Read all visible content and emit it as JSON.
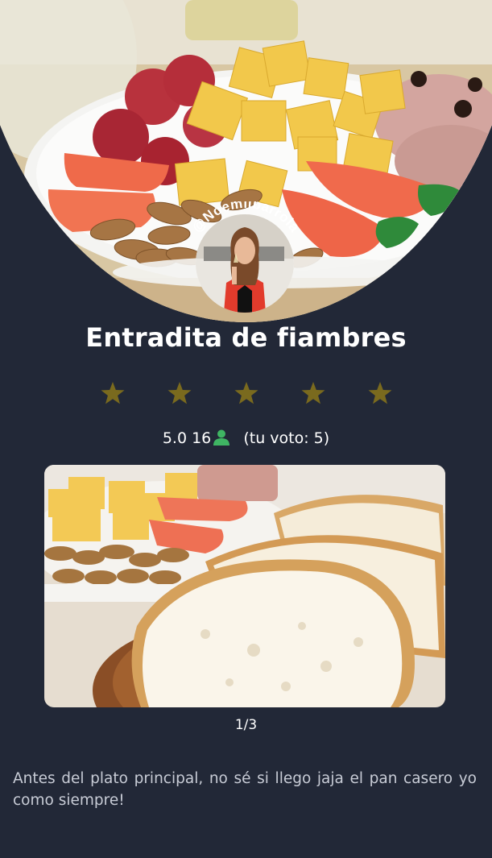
{
  "recipe": {
    "title": "Entradita de fiambres",
    "author_handle": "@Noemiibarrola",
    "rating_average": "5.0",
    "rating_count": "16",
    "your_vote": "(tu voto: 5)",
    "stars_filled": 5,
    "stars_total": 5,
    "gallery_pager": "1/3",
    "description": "Antes del plato principal, no sé si llego jaja el pan casero yo como siempre!"
  },
  "icons": {
    "star": "star-icon",
    "user": "user-icon"
  },
  "colors": {
    "background": "#222837",
    "star": "#7a6a1e",
    "user_icon": "#3fb563",
    "text": "#ffffff",
    "description_text": "#c8ccd6"
  }
}
